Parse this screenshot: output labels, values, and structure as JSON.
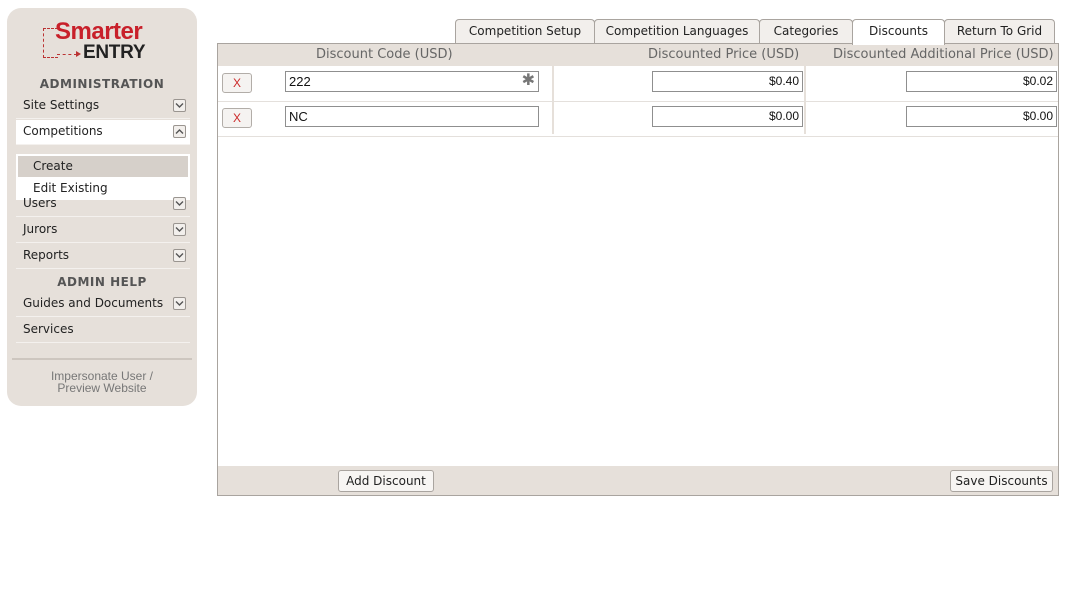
{
  "logo": {
    "line1": "Smarter",
    "line2": "ENTRY"
  },
  "sidebar": {
    "administration_title": "ADMINISTRATION",
    "admin_help_title": "ADMIN HELP",
    "items": [
      {
        "label": "Site Settings"
      },
      {
        "label": "Competitions"
      },
      {
        "label": "Users"
      },
      {
        "label": "Jurors"
      },
      {
        "label": "Reports"
      },
      {
        "label": "Guides and Documents"
      },
      {
        "label": "Services"
      }
    ],
    "competitions_sub": [
      {
        "label": "Create"
      },
      {
        "label": "Edit Existing"
      }
    ],
    "impersonate_line1": "Impersonate User /",
    "impersonate_line2": "Preview Website"
  },
  "tabs": [
    {
      "label": "Competition Setup"
    },
    {
      "label": "Competition Languages"
    },
    {
      "label": "Categories"
    },
    {
      "label": "Discounts"
    },
    {
      "label": "Return To Grid"
    }
  ],
  "table": {
    "headers": [
      "Discount Code (USD)",
      "Discounted Price (USD)",
      "Discounted Additional Price (USD)"
    ],
    "rows": [
      {
        "delete_label": "X",
        "code": "222",
        "price": "$0.40",
        "additional": "$0.02"
      },
      {
        "delete_label": "X",
        "code": "NC",
        "price": "$0.00",
        "additional": "$0.00"
      }
    ],
    "required_marker": "✱"
  },
  "footer": {
    "add_label": "Add Discount",
    "save_label": "Save Discounts"
  },
  "colors": {
    "brand_red": "#c8202a",
    "sidebar_bg": "#e6e0da",
    "delete_red": "#cc2a2a"
  }
}
